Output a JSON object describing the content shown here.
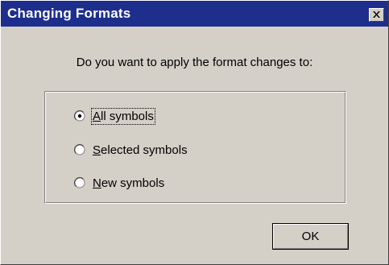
{
  "window": {
    "title": "Changing Formats",
    "titlebar_color": "#1d2e8c",
    "close_icon": "close-icon"
  },
  "prompt": "Do you want to apply the format changes to:",
  "options": [
    {
      "label": "All symbols",
      "mnemonic": "A",
      "rest": "ll symbols",
      "selected": true
    },
    {
      "label": "Selected symbols",
      "mnemonic": "S",
      "rest": "elected symbols",
      "selected": false
    },
    {
      "label": "New symbols",
      "mnemonic": "N",
      "rest": "ew symbols",
      "selected": false
    }
  ],
  "buttons": {
    "ok_label": "OK"
  }
}
